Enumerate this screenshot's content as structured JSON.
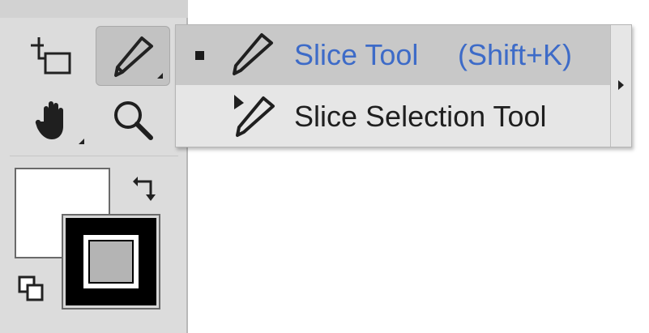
{
  "toolbar": {
    "tools": [
      {
        "name": "artboard-tool",
        "icon": "artboard-icon",
        "active": false
      },
      {
        "name": "slice-tool",
        "icon": "slice-knife-icon",
        "active": true
      },
      {
        "name": "hand-tool",
        "icon": "hand-icon",
        "active": false
      },
      {
        "name": "zoom-tool",
        "icon": "magnifier-icon",
        "active": false
      }
    ],
    "colors": {
      "fill": "#ffffff",
      "stroke": "#000000"
    }
  },
  "flyout": {
    "items": [
      {
        "label": "Slice Tool",
        "shortcut": "(Shift+K)",
        "selected": true,
        "icon": "slice-knife-icon"
      },
      {
        "label": "Slice Selection Tool",
        "shortcut": "",
        "selected": false,
        "icon": "slice-selection-icon"
      }
    ],
    "colors": {
      "selected_text": "#3d6bc8",
      "normal_text": "#1f1f1f",
      "background": "#e6e6e6",
      "selected_background": "#c8c8c8"
    }
  }
}
